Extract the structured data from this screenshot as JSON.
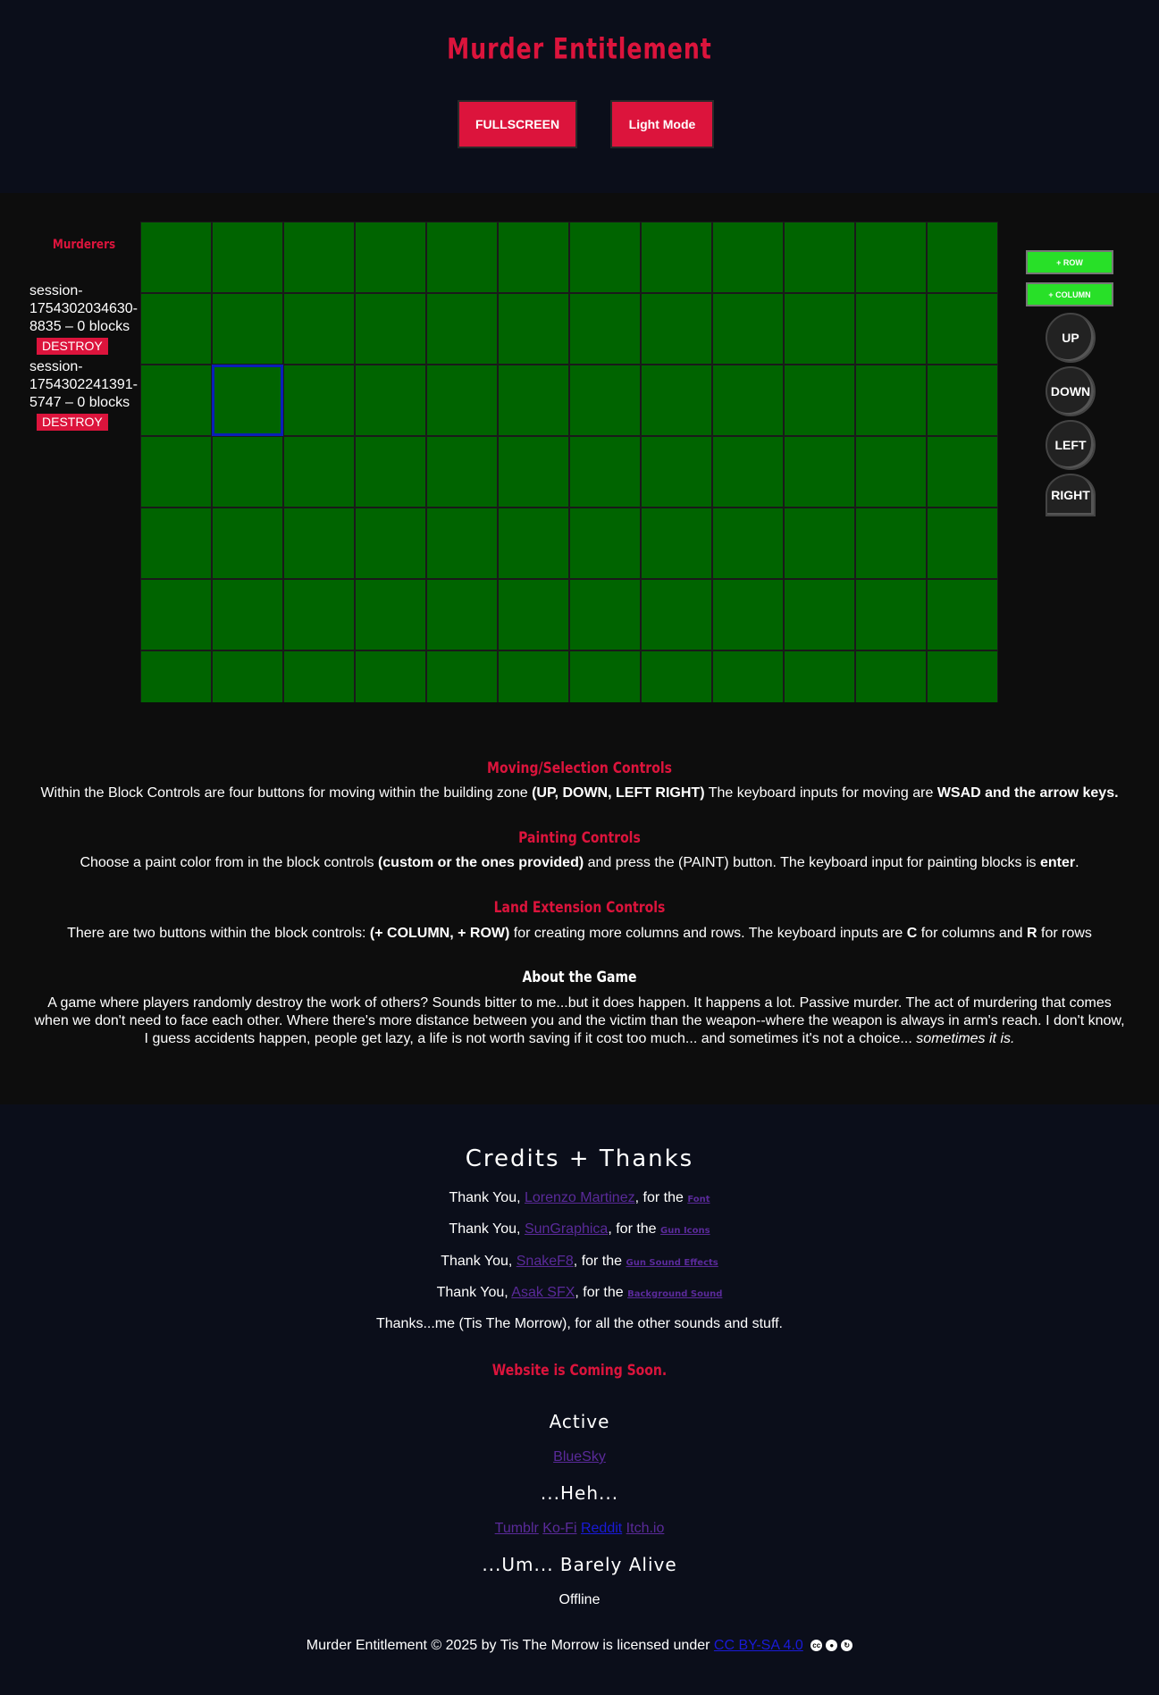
{
  "header": {
    "title": "Murder Entitlement",
    "fullscreen_label": "FULLSCREEN",
    "lightmode_label": "Light Mode"
  },
  "sidebar": {
    "title": "Murderers",
    "sessions": [
      {
        "label": "session-1754302034630-8835 – 0 blocks",
        "destroy": "DESTROY"
      },
      {
        "label": "session-1754302241391-5747 – 0 blocks",
        "destroy": "DESTROY"
      }
    ]
  },
  "grid": {
    "columns": 12,
    "rows": 7,
    "cell_color": "#006400",
    "selected_row": 2,
    "selected_col": 1,
    "selected_color": "#0a1fb8"
  },
  "controls": {
    "add_row": "+ ROW",
    "add_column": "+ COLUMN",
    "up": "UP",
    "down": "DOWN",
    "left": "LEFT",
    "right": "RIGHT"
  },
  "info": {
    "moving_title": "Moving/Selection Controls",
    "moving_text_1": "Within the Block Controls are four buttons for moving within the building zone ",
    "moving_bold_1": "(UP, DOWN, LEFT RIGHT)",
    "moving_text_2": " The keyboard inputs for moving are ",
    "moving_bold_2": "WSAD and the arrow keys.",
    "painting_title": "Painting Controls",
    "painting_text_1": "Choose a paint color from in the block controls ",
    "painting_bold_1": "(custom or the ones provided)",
    "painting_text_2": " and press the (PAINT) button. The keyboard input for painting blocks is ",
    "painting_bold_2": "enter",
    "painting_text_3": ".",
    "land_title": "Land Extension Controls",
    "land_text_1": "There are two buttons within the block controls: ",
    "land_bold_1": "(+ COLUMN, + ROW)",
    "land_text_2": " for creating more columns and rows. The keyboard inputs are ",
    "land_bold_2": "C",
    "land_text_3": " for columns and ",
    "land_bold_3": "R",
    "land_text_4": " for rows",
    "about_title": "About the Game",
    "about_text": "A game where players randomly destroy the work of others? Sounds bitter to me...but it does happen. It happens a lot. Passive murder. The act of murdering that comes when we don't need to face each other. Where there's more distance between you and the victim than the weapon--where the weapon is always in arm's reach. I don't know, I guess accidents happen, people get lazy, a life is not worth saving if it cost too much... and sometimes it's not a choice... ",
    "about_italic": "sometimes it is."
  },
  "credits": {
    "title": "Credits + Thanks",
    "thanks": [
      {
        "prefix": "Thank You, ",
        "name": "Lorenzo Martinez",
        "mid": ", for the ",
        "item": "Font"
      },
      {
        "prefix": "Thank You, ",
        "name": "SunGraphica",
        "mid": ", for the ",
        "item": "Gun Icons"
      },
      {
        "prefix": "Thank You, ",
        "name": "SnakeF8",
        "mid": ", for the ",
        "item": "Gun Sound Effects"
      },
      {
        "prefix": "Thank You, ",
        "name": "Asak SFX",
        "mid": ", for the ",
        "item": "Background Sound"
      }
    ],
    "self_thanks": "Thanks...me (Tis The Morrow), for all the other sounds and stuff.",
    "coming_soon": "Website is Coming Soon.",
    "active_title": "Active",
    "active_link": "BlueSky",
    "heh_title": "...Heh...",
    "heh_links": [
      "Tumblr",
      "Ko-Fi",
      "Reddit",
      "Itch.io"
    ],
    "barely_title": "...Um... Barely Alive",
    "barely_text": "Offline",
    "license_text": "Murder Entitlement © 2025 by Tis The Morrow is licensed under ",
    "license_link": "CC BY-SA 4.0",
    "cc_icons": [
      "cc-icon",
      "by-icon",
      "sa-icon"
    ]
  }
}
